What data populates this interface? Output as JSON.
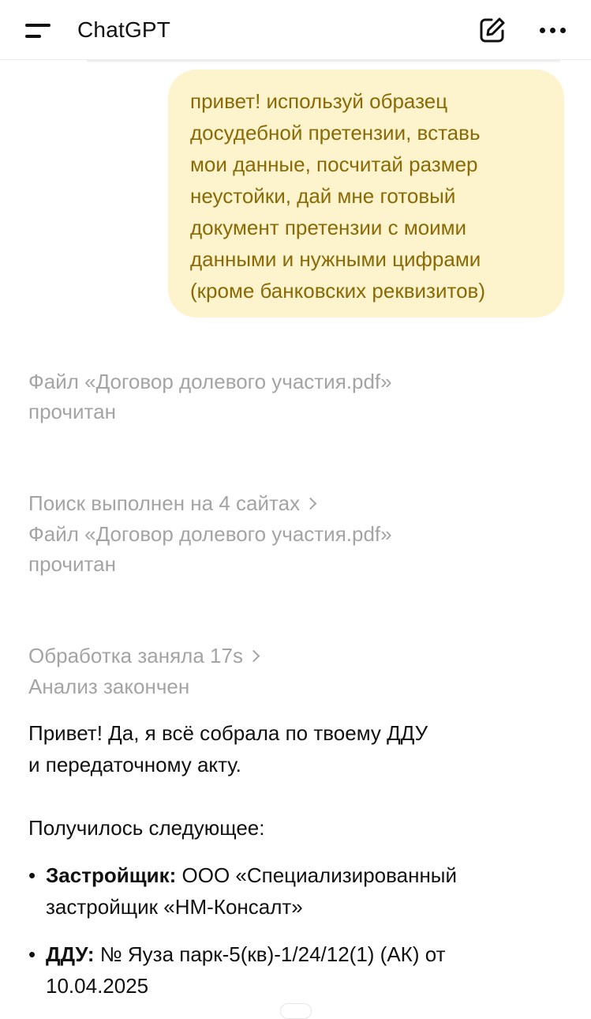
{
  "header": {
    "title": "ChatGPT",
    "menu_icon": "menu-icon",
    "new_chat_icon": "edit-icon",
    "more_icon": "more-horizontal-icon"
  },
  "user_message": {
    "text": "привет! используй образец\nдосудебной претензии, вставь\nмои данные, посчитай размер\nнеустойки, дай мне готовый\nдокумент претензии с моими\nданными и нужными цифрами\n(кроме банковских реквизитов)"
  },
  "statuses": [
    {
      "text": "Файл «Договор долевого участия.pdf»\nпрочитан"
    },
    {
      "text": "Поиск выполнен на 4 сайтах"
    },
    {
      "text": "Файл «Договор долевого участия.pdf»\nпрочитан"
    },
    {
      "text": "Обработка заняла 17s"
    },
    {
      "text": "Анализ закончен"
    }
  ],
  "assistant": {
    "intro": "Привет! Да, я всё собрала по твоему ДДУ\nи передаточному акту.",
    "result_heading": "Получилось следующее:",
    "bullets": [
      {
        "label": "Застройщик:",
        "value": " ООО «Специализированный\nзастройщик «НМ-Консалт»"
      },
      {
        "label": "ДДУ:",
        "value": " № Яуза парк-5(кв)-1/24/12(1) (АК) от\n10.04.2025"
      }
    ]
  },
  "colors": {
    "user_bubble_bg": "#fdf3cd",
    "user_text": "#8a6a05",
    "status_text": "#a4a4a4"
  }
}
